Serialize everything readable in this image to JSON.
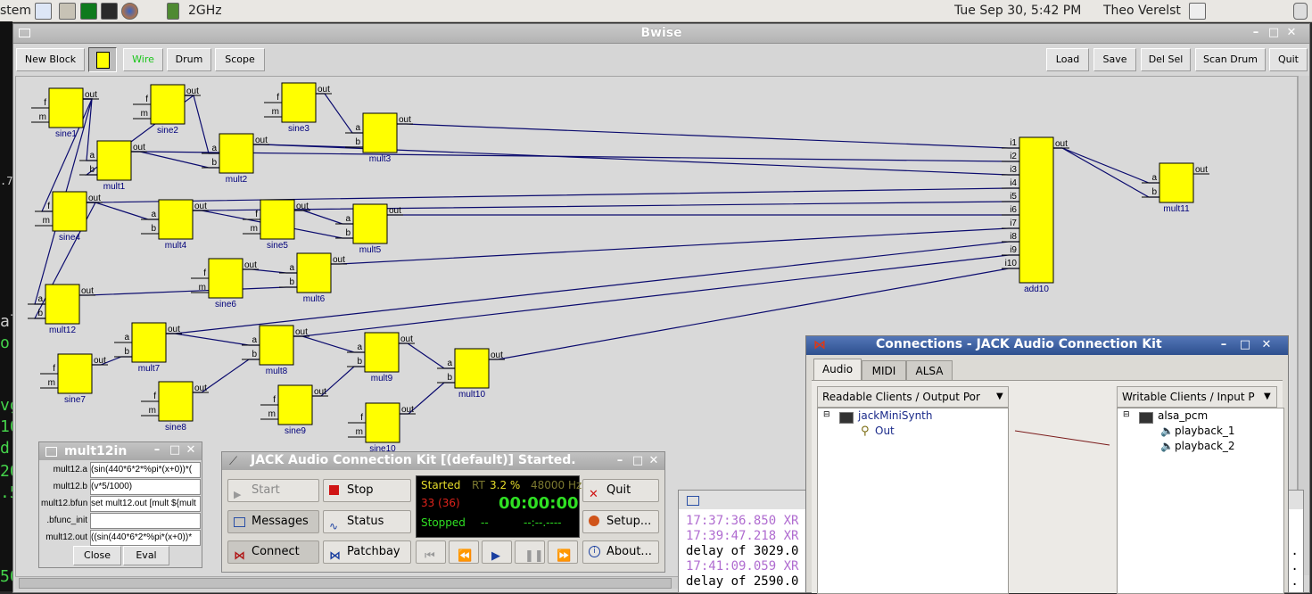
{
  "topbar": {
    "system_menu": "stem",
    "cpu_freq": "2GHz",
    "clock": "Tue Sep 30,  5:42 PM",
    "user": "Theo Verelst"
  },
  "desktop_left_text": [
    ".7",
    "al",
    "or",
    "vg",
    "10",
    "d-",
    "20",
    ".5",
    "50"
  ],
  "bwise": {
    "title": "Bwise",
    "toolbar_left": [
      "New Block",
      "Wire",
      "Drum",
      "Scope"
    ],
    "toolbar_right": [
      "Load",
      "Save",
      "Del Sel",
      "Scan Drum",
      "Quit"
    ],
    "wire_color": "#19c519"
  },
  "blocks": [
    {
      "name": "sine1",
      "ins": [
        "f",
        "m"
      ],
      "out": "out"
    },
    {
      "name": "sine2",
      "ins": [
        "f",
        "m"
      ],
      "out": "out"
    },
    {
      "name": "sine3",
      "ins": [
        "f",
        "m"
      ],
      "out": "out"
    },
    {
      "name": "mult1",
      "ins": [
        "a",
        "b"
      ],
      "out": "out"
    },
    {
      "name": "mult2",
      "ins": [
        "a",
        "b"
      ],
      "out": "out"
    },
    {
      "name": "mult3",
      "ins": [
        "a",
        "b"
      ],
      "out": "out"
    },
    {
      "name": "sine4",
      "ins": [
        "f",
        "m"
      ],
      "out": "out"
    },
    {
      "name": "mult4",
      "ins": [
        "a",
        "b"
      ],
      "out": "out"
    },
    {
      "name": "sine5",
      "ins": [
        "f",
        "m"
      ],
      "out": "out"
    },
    {
      "name": "mult5",
      "ins": [
        "a",
        "b"
      ],
      "out": "out"
    },
    {
      "name": "sine6",
      "ins": [
        "f",
        "m"
      ],
      "out": "out"
    },
    {
      "name": "mult6",
      "ins": [
        "a",
        "b"
      ],
      "out": "out"
    },
    {
      "name": "mult12",
      "ins": [
        "a",
        "b"
      ],
      "out": "out"
    },
    {
      "name": "mult7",
      "ins": [
        "a",
        "b"
      ],
      "out": "out"
    },
    {
      "name": "sine7",
      "ins": [
        "f",
        "m"
      ],
      "out": "out"
    },
    {
      "name": "mult8",
      "ins": [
        "a",
        "b"
      ],
      "out": "out"
    },
    {
      "name": "sine8",
      "ins": [
        "f",
        "m"
      ],
      "out": "out"
    },
    {
      "name": "mult9",
      "ins": [
        "a",
        "b"
      ],
      "out": "out"
    },
    {
      "name": "sine9",
      "ins": [
        "f",
        "m"
      ],
      "out": "out"
    },
    {
      "name": "mult10",
      "ins": [
        "a",
        "b"
      ],
      "out": "out"
    },
    {
      "name": "sine10",
      "ins": [
        "f",
        "m"
      ],
      "out": "out"
    },
    {
      "name": "add10",
      "ins": [
        "i1",
        "i2",
        "i3",
        "i4",
        "i5",
        "i6",
        "i7",
        "i8",
        "i9",
        "i10"
      ],
      "out": "out"
    },
    {
      "name": "mult11",
      "ins": [
        "a",
        "b"
      ],
      "out": "out"
    }
  ],
  "mult12_window": {
    "title": "mult12in",
    "rows": [
      {
        "key": "mult12.a",
        "value": "(sin(440*6*2*%pi*(x+0))*("
      },
      {
        "key": "mult12.b",
        "value": "(v*5/1000)"
      },
      {
        "key": "mult12.bfunc",
        "value": "set mult12.out [mult ${mult"
      },
      {
        "key": ".bfunc_init",
        "value": ""
      },
      {
        "key": "mult12.out",
        "value": "((sin(440*6*2*%pi*(x+0))*"
      }
    ],
    "buttons": [
      "Close",
      "Eval"
    ]
  },
  "jack": {
    "title": "JACK Audio Connection Kit [(default)] Started.",
    "buttons": {
      "start": "Start",
      "stop": "Stop",
      "quit": "Quit",
      "messages": "Messages",
      "status": "Status",
      "setup": "Setup...",
      "connect": "Connect",
      "patchbay": "Patchbay",
      "about": "About..."
    },
    "display": {
      "state": "Started",
      "rt_label": "RT",
      "rt_value": "3.2 %",
      "rate": "48000 Hz",
      "xruns": "33 (36)",
      "time": "00:00:00",
      "transport": "Stopped",
      "tdash": "--",
      "bbt": "--:--.----"
    }
  },
  "terminal": {
    "lines": [
      {
        "text": "17:37:36.850 XR",
        "color": "#b06cd0"
      },
      {
        "text": "17:39:47.218 XR",
        "color": "#b06cd0"
      },
      {
        "text": "delay of 3029.0",
        "color": "#000000"
      },
      {
        "text": "17:41:09.059 XR",
        "color": "#b06cd0"
      },
      {
        "text": "delay of 2590.0",
        "color": "#000000"
      }
    ],
    "right_dots": [
      "..",
      "..",
      ".."
    ]
  },
  "connections": {
    "title": "Connections - JACK Audio Connection Kit",
    "tabs": [
      "Audio",
      "MIDI",
      "ALSA"
    ],
    "readable_header": "Readable Clients / Output Por",
    "writable_header": "Writable Clients / Input P",
    "readable": {
      "client": "jackMiniSynth",
      "ports": [
        "Out"
      ]
    },
    "writable": {
      "client": "alsa_pcm",
      "ports": [
        "playback_1",
        "playback_2"
      ]
    }
  }
}
